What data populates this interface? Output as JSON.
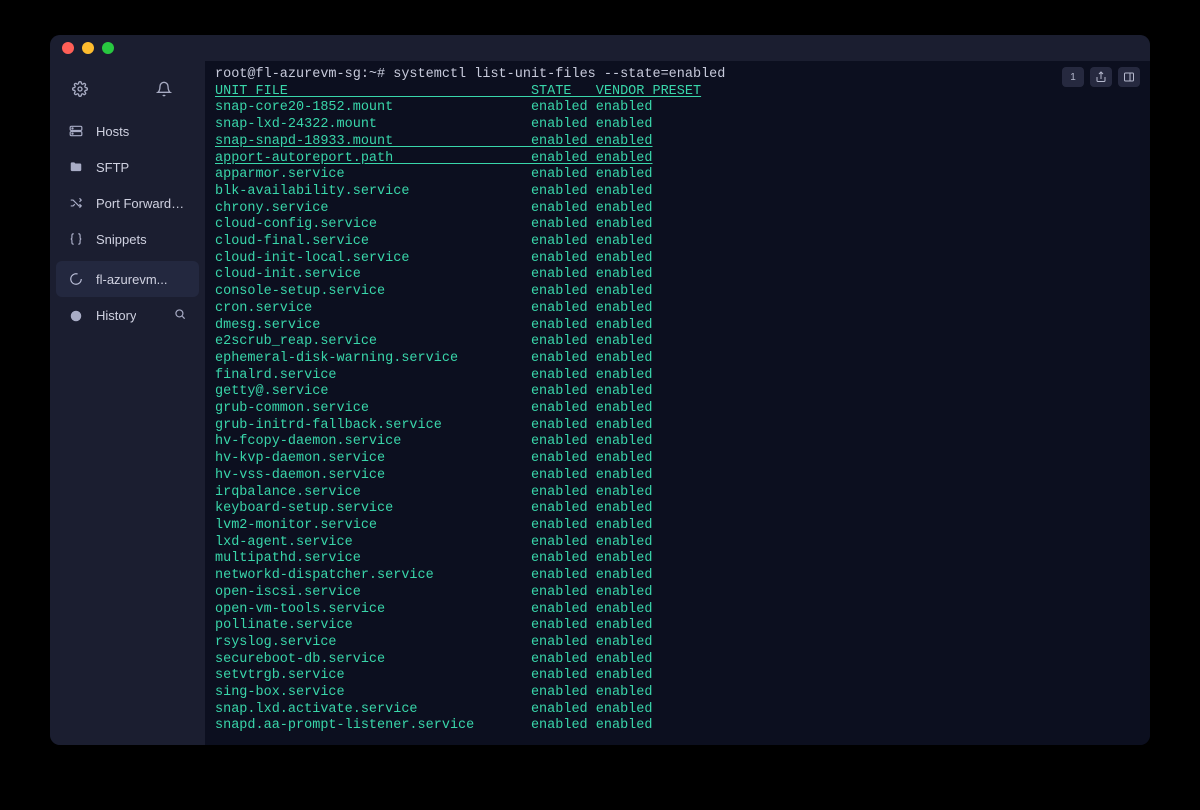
{
  "sidebar": {
    "nav": [
      {
        "key": "hosts",
        "label": "Hosts",
        "icon": "server-icon"
      },
      {
        "key": "sftp",
        "label": "SFTP",
        "icon": "folder-icon"
      },
      {
        "key": "portfw",
        "label": "Port Forwarding",
        "icon": "shuffle-icon"
      },
      {
        "key": "snip",
        "label": "Snippets",
        "icon": "braces-icon"
      }
    ],
    "session": {
      "label": "fl-azurevm...",
      "icon": "spinner-icon"
    },
    "history": {
      "label": "History",
      "icon": "clock-icon"
    }
  },
  "toolbar": {
    "num": "1",
    "share": "share-icon",
    "panel": "panel-icon"
  },
  "terminal": {
    "prompt": "root@fl-azurevm-sg:~# ",
    "command": "systemctl list-unit-files --state=enabled",
    "header": "UNIT FILE                              STATE   VENDOR PRESET",
    "col_pad": 39,
    "units": [
      {
        "u": "snap-core20-1852.mount",
        "s": "enabled",
        "p": "enabled",
        "ul": false
      },
      {
        "u": "snap-lxd-24322.mount",
        "s": "enabled",
        "p": "enabled",
        "ul": false
      },
      {
        "u": "snap-snapd-18933.mount",
        "s": "enabled",
        "p": "enabled",
        "ul": true
      },
      {
        "u": "apport-autoreport.path",
        "s": "enabled",
        "p": "enabled",
        "ul": true
      },
      {
        "u": "apparmor.service",
        "s": "enabled",
        "p": "enabled",
        "ul": false
      },
      {
        "u": "blk-availability.service",
        "s": "enabled",
        "p": "enabled",
        "ul": false
      },
      {
        "u": "chrony.service",
        "s": "enabled",
        "p": "enabled",
        "ul": false
      },
      {
        "u": "cloud-config.service",
        "s": "enabled",
        "p": "enabled",
        "ul": false
      },
      {
        "u": "cloud-final.service",
        "s": "enabled",
        "p": "enabled",
        "ul": false
      },
      {
        "u": "cloud-init-local.service",
        "s": "enabled",
        "p": "enabled",
        "ul": false
      },
      {
        "u": "cloud-init.service",
        "s": "enabled",
        "p": "enabled",
        "ul": false
      },
      {
        "u": "console-setup.service",
        "s": "enabled",
        "p": "enabled",
        "ul": false
      },
      {
        "u": "cron.service",
        "s": "enabled",
        "p": "enabled",
        "ul": false
      },
      {
        "u": "dmesg.service",
        "s": "enabled",
        "p": "enabled",
        "ul": false
      },
      {
        "u": "e2scrub_reap.service",
        "s": "enabled",
        "p": "enabled",
        "ul": false
      },
      {
        "u": "ephemeral-disk-warning.service",
        "s": "enabled",
        "p": "enabled",
        "ul": false
      },
      {
        "u": "finalrd.service",
        "s": "enabled",
        "p": "enabled",
        "ul": false
      },
      {
        "u": "getty@.service",
        "s": "enabled",
        "p": "enabled",
        "ul": false
      },
      {
        "u": "grub-common.service",
        "s": "enabled",
        "p": "enabled",
        "ul": false
      },
      {
        "u": "grub-initrd-fallback.service",
        "s": "enabled",
        "p": "enabled",
        "ul": false
      },
      {
        "u": "hv-fcopy-daemon.service",
        "s": "enabled",
        "p": "enabled",
        "ul": false
      },
      {
        "u": "hv-kvp-daemon.service",
        "s": "enabled",
        "p": "enabled",
        "ul": false
      },
      {
        "u": "hv-vss-daemon.service",
        "s": "enabled",
        "p": "enabled",
        "ul": false
      },
      {
        "u": "irqbalance.service",
        "s": "enabled",
        "p": "enabled",
        "ul": false
      },
      {
        "u": "keyboard-setup.service",
        "s": "enabled",
        "p": "enabled",
        "ul": false
      },
      {
        "u": "lvm2-monitor.service",
        "s": "enabled",
        "p": "enabled",
        "ul": false
      },
      {
        "u": "lxd-agent.service",
        "s": "enabled",
        "p": "enabled",
        "ul": false
      },
      {
        "u": "multipathd.service",
        "s": "enabled",
        "p": "enabled",
        "ul": false
      },
      {
        "u": "networkd-dispatcher.service",
        "s": "enabled",
        "p": "enabled",
        "ul": false
      },
      {
        "u": "open-iscsi.service",
        "s": "enabled",
        "p": "enabled",
        "ul": false
      },
      {
        "u": "open-vm-tools.service",
        "s": "enabled",
        "p": "enabled",
        "ul": false
      },
      {
        "u": "pollinate.service",
        "s": "enabled",
        "p": "enabled",
        "ul": false
      },
      {
        "u": "rsyslog.service",
        "s": "enabled",
        "p": "enabled",
        "ul": false
      },
      {
        "u": "secureboot-db.service",
        "s": "enabled",
        "p": "enabled",
        "ul": false
      },
      {
        "u": "setvtrgb.service",
        "s": "enabled",
        "p": "enabled",
        "ul": false
      },
      {
        "u": "sing-box.service",
        "s": "enabled",
        "p": "enabled",
        "ul": false
      },
      {
        "u": "snap.lxd.activate.service",
        "s": "enabled",
        "p": "enabled",
        "ul": false
      },
      {
        "u": "snapd.aa-prompt-listener.service",
        "s": "enabled",
        "p": "enabled",
        "ul": false
      }
    ]
  }
}
